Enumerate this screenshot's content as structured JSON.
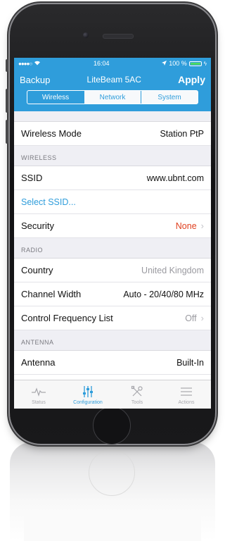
{
  "status_bar": {
    "time": "16:04",
    "battery": "100 %"
  },
  "navbar": {
    "left_button": "Backup",
    "title": "LiteBeam 5AC",
    "right_button": "Apply"
  },
  "segments": [
    {
      "label": "Wireless",
      "active": true
    },
    {
      "label": "Network",
      "active": false
    },
    {
      "label": "System",
      "active": false
    }
  ],
  "wireless_mode": {
    "label": "Wireless Mode",
    "value": "Station PtP"
  },
  "sections": {
    "wireless": "WIRELESS",
    "radio": "RADIO",
    "antenna": "ANTENNA"
  },
  "wireless": {
    "ssid": {
      "label": "SSID",
      "value": "www.ubnt.com"
    },
    "select_ssid": "Select SSID...",
    "security": {
      "label": "Security",
      "value": "None"
    }
  },
  "radio": {
    "country": {
      "label": "Country",
      "value": "United Kingdom"
    },
    "channel_width": {
      "label": "Channel Width",
      "value": "Auto - 20/40/80 MHz"
    },
    "control_frequency": {
      "label": "Control Frequency List",
      "value": "Off"
    }
  },
  "antenna": {
    "antenna": {
      "label": "Antenna",
      "value": "Built-In"
    }
  },
  "tabbar": [
    {
      "label": "Status",
      "icon": "pulse-icon",
      "active": false
    },
    {
      "label": "Configuration",
      "icon": "sliders-icon",
      "active": true
    },
    {
      "label": "Tools",
      "icon": "tools-icon",
      "active": false
    },
    {
      "label": "Actions",
      "icon": "menu-icon",
      "active": false
    }
  ],
  "colors": {
    "accent": "#2f9ddb",
    "danger": "#e0401f",
    "battery_fill": "#4cd964"
  }
}
